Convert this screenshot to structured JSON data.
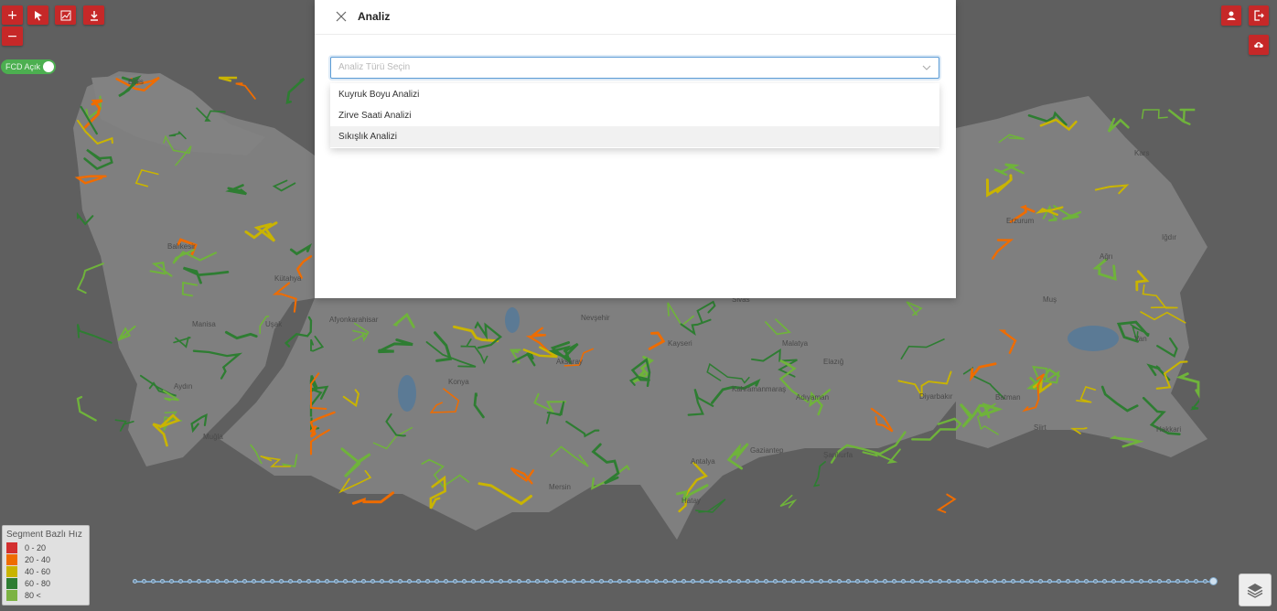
{
  "toolbar": {
    "zoom_in_label": "+",
    "zoom_out_label": "−",
    "select_icon": "cursor-icon",
    "chart_icon": "chart-icon",
    "download_icon": "download-icon"
  },
  "fcd_toggle": {
    "label": "FCD Açık",
    "state": "on"
  },
  "dialog": {
    "title": "Analiz",
    "select_placeholder": "Analiz Türü Seçin",
    "options": [
      "Kuyruk Boyu Analizi",
      "Zirve Saati Analizi",
      "Sıkışlık Analizi"
    ],
    "highlighted_index": 2
  },
  "right_buttons": [
    "user-icon",
    "logout-icon",
    "cloud-upload-icon"
  ],
  "legend": {
    "title": "Segment Bazlı Hız",
    "items": [
      {
        "label": "0 - 20",
        "color": "#d32f2f"
      },
      {
        "label": "20 - 40",
        "color": "#ef6c00"
      },
      {
        "label": "40 - 60",
        "color": "#c9b400"
      },
      {
        "label": "60 - 80",
        "color": "#2e7d32"
      },
      {
        "label": "80 <",
        "color": "#7cb342"
      }
    ]
  },
  "map": {
    "city_labels": [
      "Bitlis",
      "Balıkesir",
      "Kütahya",
      "Manisa",
      "Uşak",
      "Aydın",
      "Muğla",
      "Afyonkarahisar",
      "Konya",
      "Aksaray",
      "Nevşehir",
      "Kayseri",
      "Sivas",
      "Malatya",
      "Kahramanmaraş",
      "Adıyaman",
      "Gaziantep",
      "Şanlıurfa",
      "Diyarbakır",
      "Batman",
      "Hatay",
      "Antalya",
      "Mersin",
      "Erzurum",
      "Ağrı",
      "Van",
      "Hakkari",
      "Siirt",
      "Elazığ",
      "Muş",
      "Iğdır",
      "Kars"
    ],
    "colors": {
      "dark_green": "#2e7d32",
      "green": "#6fb33b",
      "yellow": "#c9b400",
      "orange": "#ef6c00",
      "red": "#d32f2f"
    }
  },
  "timeline": {
    "handle_position": "end"
  }
}
